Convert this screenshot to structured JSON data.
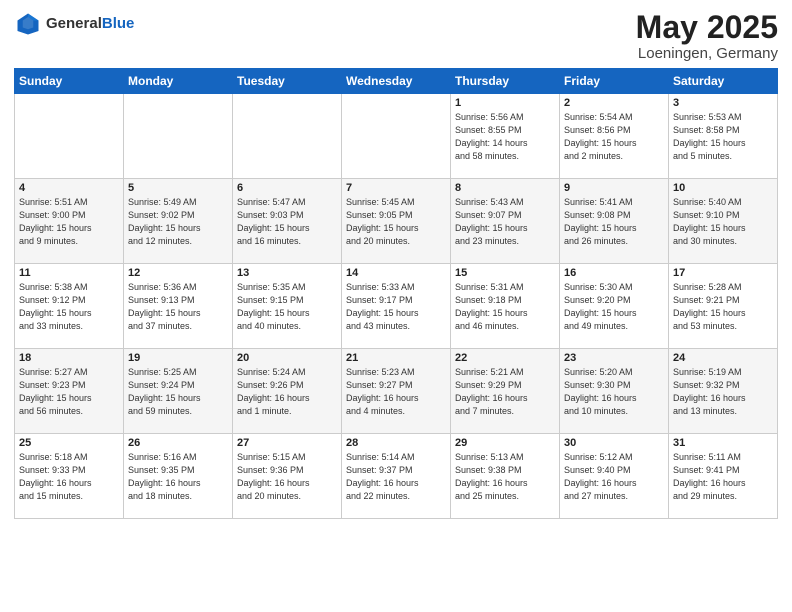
{
  "header": {
    "logo_general": "General",
    "logo_blue": "Blue",
    "month_title": "May 2025",
    "location": "Loeningen, Germany"
  },
  "weekdays": [
    "Sunday",
    "Monday",
    "Tuesday",
    "Wednesday",
    "Thursday",
    "Friday",
    "Saturday"
  ],
  "weeks": [
    [
      {
        "day": "",
        "info": ""
      },
      {
        "day": "",
        "info": ""
      },
      {
        "day": "",
        "info": ""
      },
      {
        "day": "",
        "info": ""
      },
      {
        "day": "1",
        "info": "Sunrise: 5:56 AM\nSunset: 8:55 PM\nDaylight: 14 hours\nand 58 minutes."
      },
      {
        "day": "2",
        "info": "Sunrise: 5:54 AM\nSunset: 8:56 PM\nDaylight: 15 hours\nand 2 minutes."
      },
      {
        "day": "3",
        "info": "Sunrise: 5:53 AM\nSunset: 8:58 PM\nDaylight: 15 hours\nand 5 minutes."
      }
    ],
    [
      {
        "day": "4",
        "info": "Sunrise: 5:51 AM\nSunset: 9:00 PM\nDaylight: 15 hours\nand 9 minutes."
      },
      {
        "day": "5",
        "info": "Sunrise: 5:49 AM\nSunset: 9:02 PM\nDaylight: 15 hours\nand 12 minutes."
      },
      {
        "day": "6",
        "info": "Sunrise: 5:47 AM\nSunset: 9:03 PM\nDaylight: 15 hours\nand 16 minutes."
      },
      {
        "day": "7",
        "info": "Sunrise: 5:45 AM\nSunset: 9:05 PM\nDaylight: 15 hours\nand 20 minutes."
      },
      {
        "day": "8",
        "info": "Sunrise: 5:43 AM\nSunset: 9:07 PM\nDaylight: 15 hours\nand 23 minutes."
      },
      {
        "day": "9",
        "info": "Sunrise: 5:41 AM\nSunset: 9:08 PM\nDaylight: 15 hours\nand 26 minutes."
      },
      {
        "day": "10",
        "info": "Sunrise: 5:40 AM\nSunset: 9:10 PM\nDaylight: 15 hours\nand 30 minutes."
      }
    ],
    [
      {
        "day": "11",
        "info": "Sunrise: 5:38 AM\nSunset: 9:12 PM\nDaylight: 15 hours\nand 33 minutes."
      },
      {
        "day": "12",
        "info": "Sunrise: 5:36 AM\nSunset: 9:13 PM\nDaylight: 15 hours\nand 37 minutes."
      },
      {
        "day": "13",
        "info": "Sunrise: 5:35 AM\nSunset: 9:15 PM\nDaylight: 15 hours\nand 40 minutes."
      },
      {
        "day": "14",
        "info": "Sunrise: 5:33 AM\nSunset: 9:17 PM\nDaylight: 15 hours\nand 43 minutes."
      },
      {
        "day": "15",
        "info": "Sunrise: 5:31 AM\nSunset: 9:18 PM\nDaylight: 15 hours\nand 46 minutes."
      },
      {
        "day": "16",
        "info": "Sunrise: 5:30 AM\nSunset: 9:20 PM\nDaylight: 15 hours\nand 49 minutes."
      },
      {
        "day": "17",
        "info": "Sunrise: 5:28 AM\nSunset: 9:21 PM\nDaylight: 15 hours\nand 53 minutes."
      }
    ],
    [
      {
        "day": "18",
        "info": "Sunrise: 5:27 AM\nSunset: 9:23 PM\nDaylight: 15 hours\nand 56 minutes."
      },
      {
        "day": "19",
        "info": "Sunrise: 5:25 AM\nSunset: 9:24 PM\nDaylight: 15 hours\nand 59 minutes."
      },
      {
        "day": "20",
        "info": "Sunrise: 5:24 AM\nSunset: 9:26 PM\nDaylight: 16 hours\nand 1 minute."
      },
      {
        "day": "21",
        "info": "Sunrise: 5:23 AM\nSunset: 9:27 PM\nDaylight: 16 hours\nand 4 minutes."
      },
      {
        "day": "22",
        "info": "Sunrise: 5:21 AM\nSunset: 9:29 PM\nDaylight: 16 hours\nand 7 minutes."
      },
      {
        "day": "23",
        "info": "Sunrise: 5:20 AM\nSunset: 9:30 PM\nDaylight: 16 hours\nand 10 minutes."
      },
      {
        "day": "24",
        "info": "Sunrise: 5:19 AM\nSunset: 9:32 PM\nDaylight: 16 hours\nand 13 minutes."
      }
    ],
    [
      {
        "day": "25",
        "info": "Sunrise: 5:18 AM\nSunset: 9:33 PM\nDaylight: 16 hours\nand 15 minutes."
      },
      {
        "day": "26",
        "info": "Sunrise: 5:16 AM\nSunset: 9:35 PM\nDaylight: 16 hours\nand 18 minutes."
      },
      {
        "day": "27",
        "info": "Sunrise: 5:15 AM\nSunset: 9:36 PM\nDaylight: 16 hours\nand 20 minutes."
      },
      {
        "day": "28",
        "info": "Sunrise: 5:14 AM\nSunset: 9:37 PM\nDaylight: 16 hours\nand 22 minutes."
      },
      {
        "day": "29",
        "info": "Sunrise: 5:13 AM\nSunset: 9:38 PM\nDaylight: 16 hours\nand 25 minutes."
      },
      {
        "day": "30",
        "info": "Sunrise: 5:12 AM\nSunset: 9:40 PM\nDaylight: 16 hours\nand 27 minutes."
      },
      {
        "day": "31",
        "info": "Sunrise: 5:11 AM\nSunset: 9:41 PM\nDaylight: 16 hours\nand 29 minutes."
      }
    ]
  ]
}
